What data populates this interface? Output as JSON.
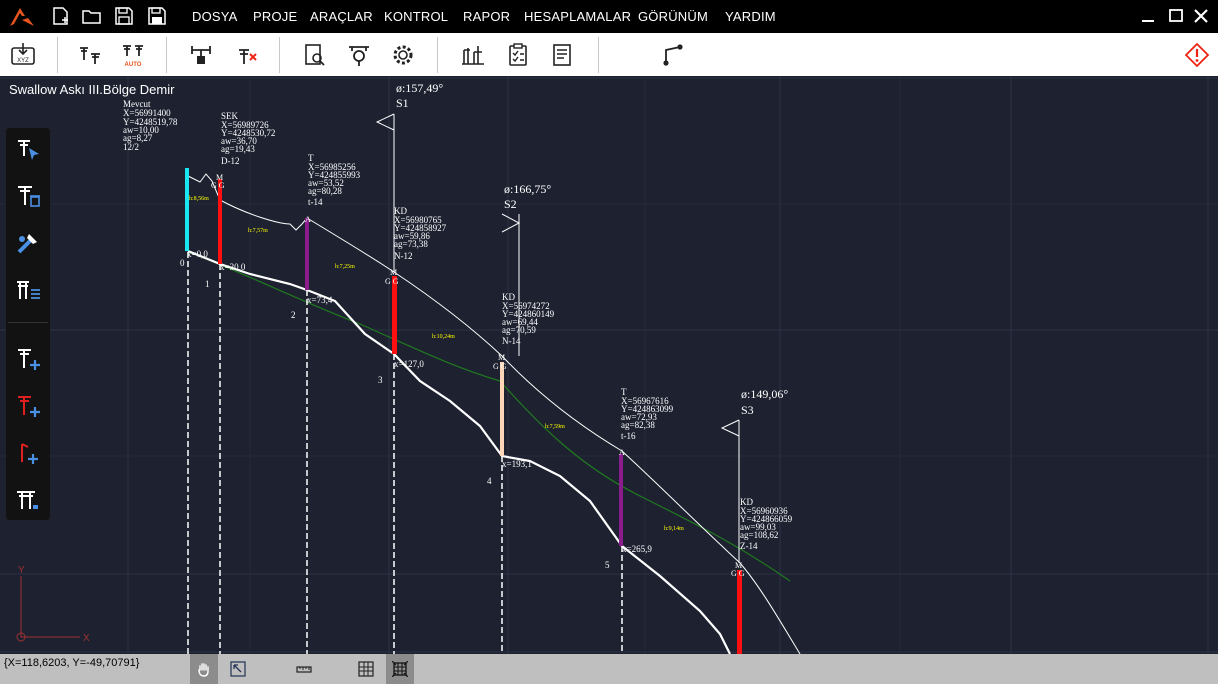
{
  "menu": [
    "DOSYA",
    "PROJE",
    "ARAÇLAR",
    "KONTROL",
    "RAPOR",
    "HESAPLAMALAR",
    "GÖRÜNÜM",
    "YARDIM"
  ],
  "toolbar": {
    "auto_label": "AUTO"
  },
  "drawing": {
    "title": "Swallow Askı III.Bölge Demir",
    "angles": [
      {
        "angle": "ø:157,49°",
        "name": "S1"
      },
      {
        "angle": "ø:166,75°",
        "name": "S2"
      },
      {
        "angle": "ø:149,06°",
        "name": "S3"
      }
    ],
    "poles": [
      {
        "num": "0",
        "x_label": "x=0,0",
        "info": [
          "Mevcut",
          "X=56991400",
          "Y=4248519,78",
          "aw=10,00",
          "ag=8,27",
          "12/2"
        ],
        "code": "",
        "height": "h:8,56m"
      },
      {
        "num": "1",
        "x_label": "x=30,0",
        "info": [
          "SEK",
          "X=56989726",
          "Y=4248530,72",
          "aw=36,70",
          "ag=19,43",
          "D-12"
        ],
        "code": "M",
        "height": "h:7,57m"
      },
      {
        "num": "2",
        "x_label": "x=73,4",
        "info": [
          "T",
          "X=56985256",
          "Y=424855993",
          "aw=53,52",
          "ag=80,28",
          "t-14"
        ],
        "code": "A",
        "height": "h:7,25m"
      },
      {
        "num": "3",
        "x_label": "x=127,0",
        "info": [
          "KD",
          "X=56980765",
          "Y=424858927",
          "aw=59,86",
          "ag=73,38",
          "N-12"
        ],
        "code": "M",
        "height": "h:10,24m"
      },
      {
        "num": "4",
        "x_label": "x=193,1",
        "info": [
          "KD",
          "X=56974272",
          "Y=424860149",
          "aw=69,44",
          "ag=70,59",
          "N-14"
        ],
        "code": "M",
        "height": "h:7,59m"
      },
      {
        "num": "5",
        "x_label": "x=265,9",
        "info": [
          "T",
          "X=56967616",
          "Y=424863099",
          "aw=72,93",
          "ag=82,38",
          "t-16"
        ],
        "code": "A",
        "height": "h:9,14m"
      },
      {
        "num": "",
        "x_label": "",
        "info": [
          "KD",
          "X=56960936",
          "Y=424866059",
          "aw=99,03",
          "ag=108,62",
          "Z-14"
        ],
        "code": "M",
        "height": ""
      }
    ],
    "gg_label": "G G",
    "axis_x": "X",
    "axis_y": "Y"
  },
  "status": {
    "coords": "{X=118,6203, Y=-49,70791}"
  },
  "colors": {
    "canvas": "#1e2230",
    "grid": "#2a3142",
    "white": "#ffffff",
    "red": "#ff1010",
    "purple": "#8b1c8b",
    "cyan": "#19e6f0",
    "peach": "#ffd6b8",
    "green": "#1f7a1f",
    "yellow": "#ffff00"
  }
}
